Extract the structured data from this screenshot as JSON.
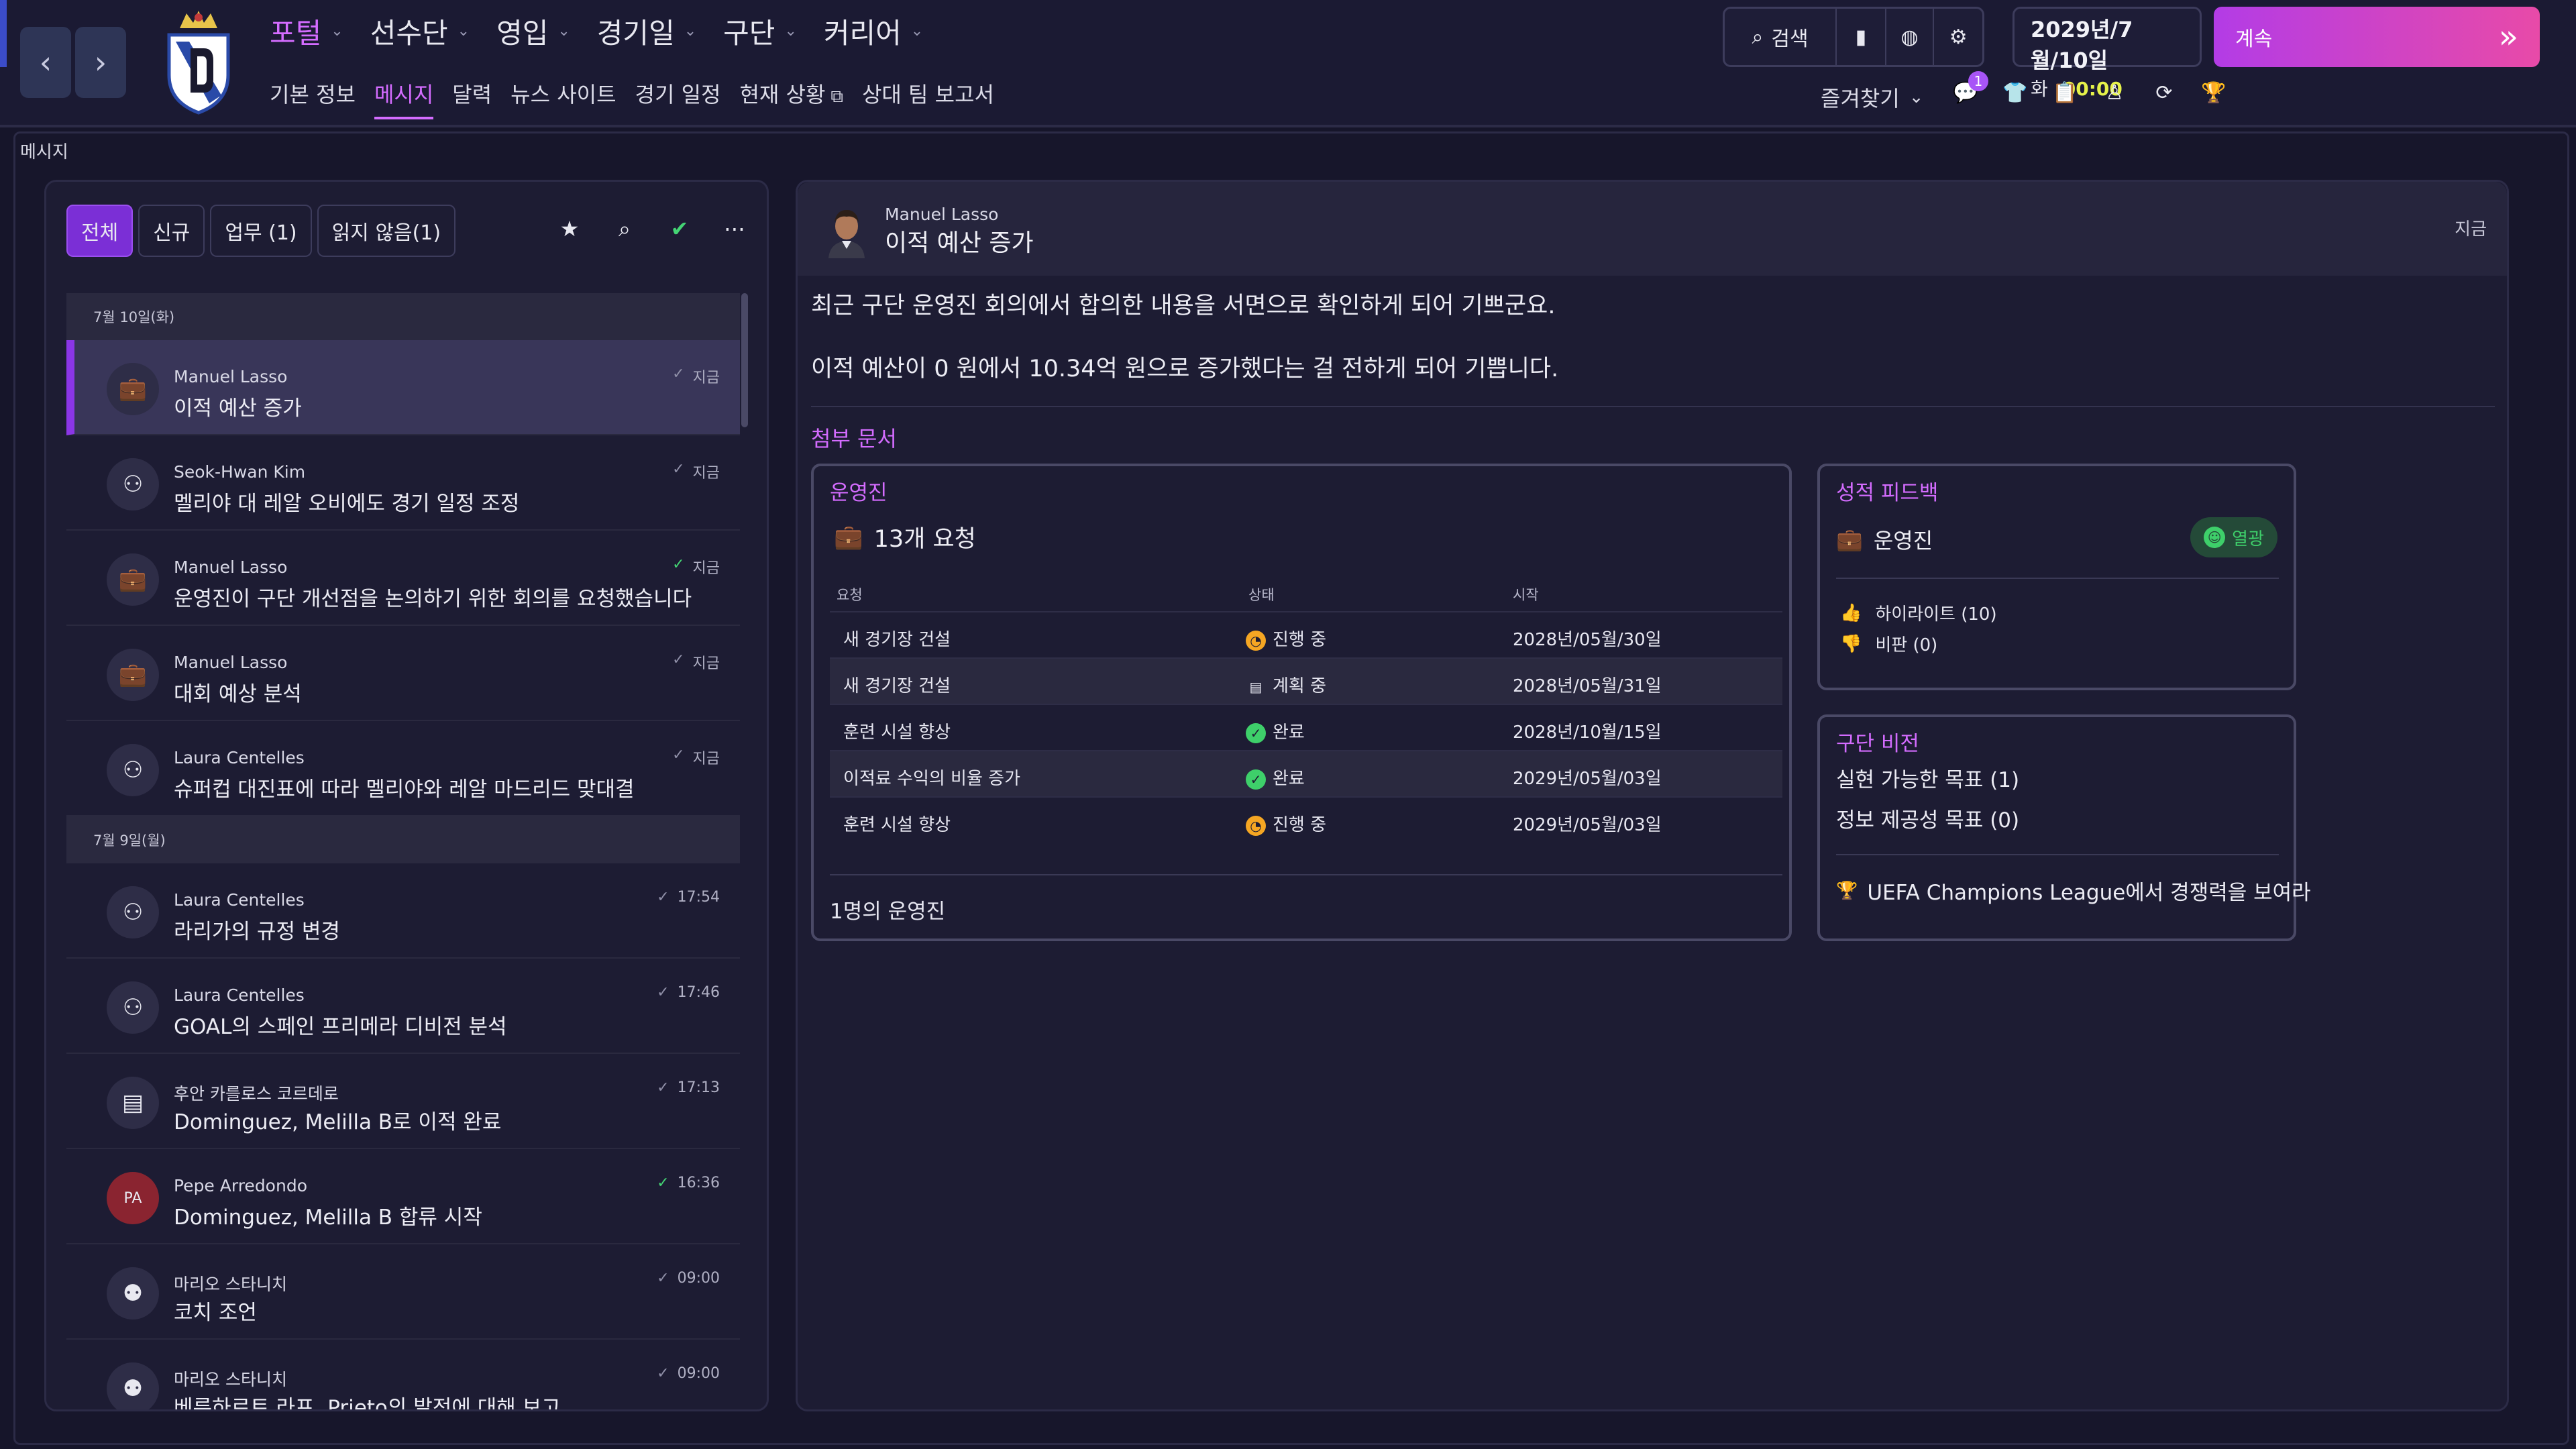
{
  "topbar": {
    "main_menu": [
      {
        "label": "포털",
        "active": true
      },
      {
        "label": "선수단",
        "active": false
      },
      {
        "label": "영입",
        "active": false
      },
      {
        "label": "경기일",
        "active": false
      },
      {
        "label": "구단",
        "active": false
      },
      {
        "label": "커리어",
        "active": false
      }
    ],
    "sub_menu": [
      {
        "label": "기본 정보",
        "active": false
      },
      {
        "label": "메시지",
        "active": true
      },
      {
        "label": "달력",
        "active": false
      },
      {
        "label": "뉴스 사이트",
        "active": false
      },
      {
        "label": "경기 일정",
        "active": false
      },
      {
        "label": "현재 상황",
        "active": false
      },
      {
        "label": "상대 팀 보고서",
        "active": false
      }
    ],
    "search_label": "검색",
    "date": "2029년/7월/10일",
    "weekday": "화",
    "time": "00:00",
    "continue_label": "계속",
    "favorites_label": "즐겨찾기",
    "notification_count": "1",
    "accent_color": "#d46cff"
  },
  "page_title": "메시지",
  "inbox": {
    "filters": [
      {
        "label": "전체",
        "active": true
      },
      {
        "label": "신규",
        "active": false
      },
      {
        "label": "업무 (1)",
        "active": false
      },
      {
        "label": "읽지 않음(1)",
        "active": false
      }
    ],
    "groups": [
      {
        "date": "7월 10일(화)",
        "messages": [
          {
            "sender": "Manuel Lasso",
            "subject": "이적 예산 증가",
            "time": "지금",
            "icon": "briefcase-icon",
            "read_green": false,
            "selected": true
          },
          {
            "sender": "Seok-Hwan Kim",
            "subject": "멜리야 대 레알 오비에도 경기 일정 조정",
            "time": "지금",
            "icon": "people-icon",
            "read_green": false,
            "selected": false
          },
          {
            "sender": "Manuel Lasso",
            "subject": "운영진이 구단 개선점을 논의하기 위한 회의를 요청했습니다",
            "time": "지금",
            "icon": "briefcase-icon",
            "read_green": true,
            "selected": false
          },
          {
            "sender": "Manuel Lasso",
            "subject": "대회 예상 분석",
            "time": "지금",
            "icon": "briefcase-icon",
            "read_green": false,
            "selected": false
          },
          {
            "sender": "Laura Centelles",
            "subject": "슈퍼컵 대진표에 따라 멜리야와 레알 마드리드 맞대결",
            "time": "지금",
            "icon": "people-icon",
            "read_green": false,
            "selected": false
          }
        ]
      },
      {
        "date": "7월 9일(월)",
        "messages": [
          {
            "sender": "Laura Centelles",
            "subject": "라리가의 규정 변경",
            "time": "17:54",
            "icon": "people-icon",
            "read_green": false,
            "selected": false
          },
          {
            "sender": "Laura Centelles",
            "subject": "GOAL의 스페인 프리메라 디비전 분석",
            "time": "17:46",
            "icon": "people-icon",
            "read_green": false,
            "selected": false
          },
          {
            "sender": "후안 카를로스 코르데로",
            "subject": "Dominguez, Melilla B로 이적 완료",
            "time": "17:13",
            "icon": "id-card-icon",
            "read_green": false,
            "selected": false
          },
          {
            "sender": "Pepe Arredondo",
            "subject": "Dominguez, Melilla B 합류 시작",
            "time": "16:36",
            "icon": "PA",
            "read_green": true,
            "selected": false
          },
          {
            "sender": "마리오 스타니치",
            "subject": "코치 조언",
            "time": "09:00",
            "icon": "group-icon",
            "read_green": false,
            "selected": false
          },
          {
            "sender": "마리오 스타니치",
            "subject": "베른하르트 라프, Prieto의 발전에 대해 보고",
            "time": "09:00",
            "icon": "group-icon",
            "read_green": false,
            "selected": false
          }
        ]
      }
    ]
  },
  "detail": {
    "from": "Manuel Lasso",
    "subject": "이적 예산 증가",
    "time": "지금",
    "body": [
      "최근 구단 운영진 회의에서 합의한 내용을 서면으로 확인하게 되어 기쁘군요.",
      "이적 예산이 0 원에서 10.34억 원으로 증가했다는 걸 전하게 되어 기쁩니다."
    ],
    "attachments_label": "첨부 문서",
    "staff_card": {
      "title": "운영진",
      "count_label": "13개 요청",
      "columns": [
        "요청",
        "상태",
        "시작"
      ],
      "rows": [
        {
          "request": "새 경기장 건설",
          "status": "진행 중",
          "status_type": "prog",
          "start": "2028년/05월/30일"
        },
        {
          "request": "새 경기장 건설",
          "status": "계획 중",
          "status_type": "plan",
          "start": "2028년/05월/31일"
        },
        {
          "request": "훈련 시설 향상",
          "status": "완료",
          "status_type": "done",
          "start": "2028년/10월/15일"
        },
        {
          "request": "이적료 수익의 비율 증가",
          "status": "완료",
          "status_type": "done",
          "start": "2029년/05월/03일"
        },
        {
          "request": "훈련 시설 향상",
          "status": "진행 중",
          "status_type": "prog",
          "start": "2029년/05월/03일"
        }
      ],
      "footer": "1명의 운영진"
    },
    "feedback_card": {
      "title": "성적 피드백",
      "dept": "운영진",
      "badge": "열광",
      "highlights": "하이라이트 (10)",
      "criticism": "비판 (0)"
    },
    "vision_card": {
      "title": "구단 비전",
      "line1": "실현 가능한 목표 (1)",
      "line2": "정보 제공성 목표 (0)",
      "goal": "UEFA Champions League에서 경쟁력을 보여라"
    }
  }
}
